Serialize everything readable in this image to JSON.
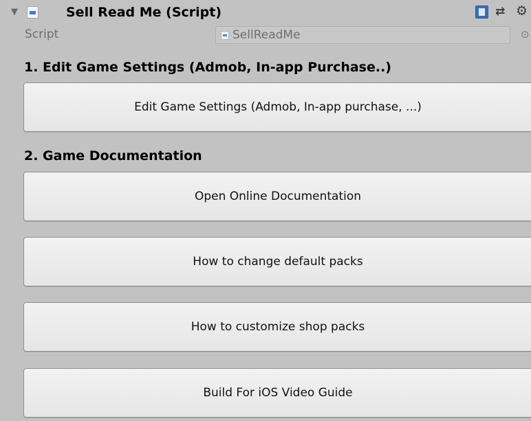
{
  "component": {
    "foldout_glyph": "▼",
    "icon": "cs-script-icon",
    "title": "Sell Read Me (Script)",
    "header_icons": [
      "help-icon",
      "preset-icon",
      "gear-icon"
    ]
  },
  "script_field": {
    "label": "Script",
    "value": "SellReadMe"
  },
  "section1": {
    "title": "1. Edit Game Settings (Admob, In-app Purchase..)",
    "button": "Edit Game Settings (Admob, In-app purchase, ...)"
  },
  "section2": {
    "title": "2. Game Documentation",
    "buttons": [
      "Open Online Documentation",
      "How to change default packs",
      "How to customize shop packs",
      "Build For iOS Video Guide"
    ]
  },
  "colors": {
    "background": "#c2c2c2",
    "button_face": "#ececec",
    "accent_blue": "#3e6fb4"
  }
}
